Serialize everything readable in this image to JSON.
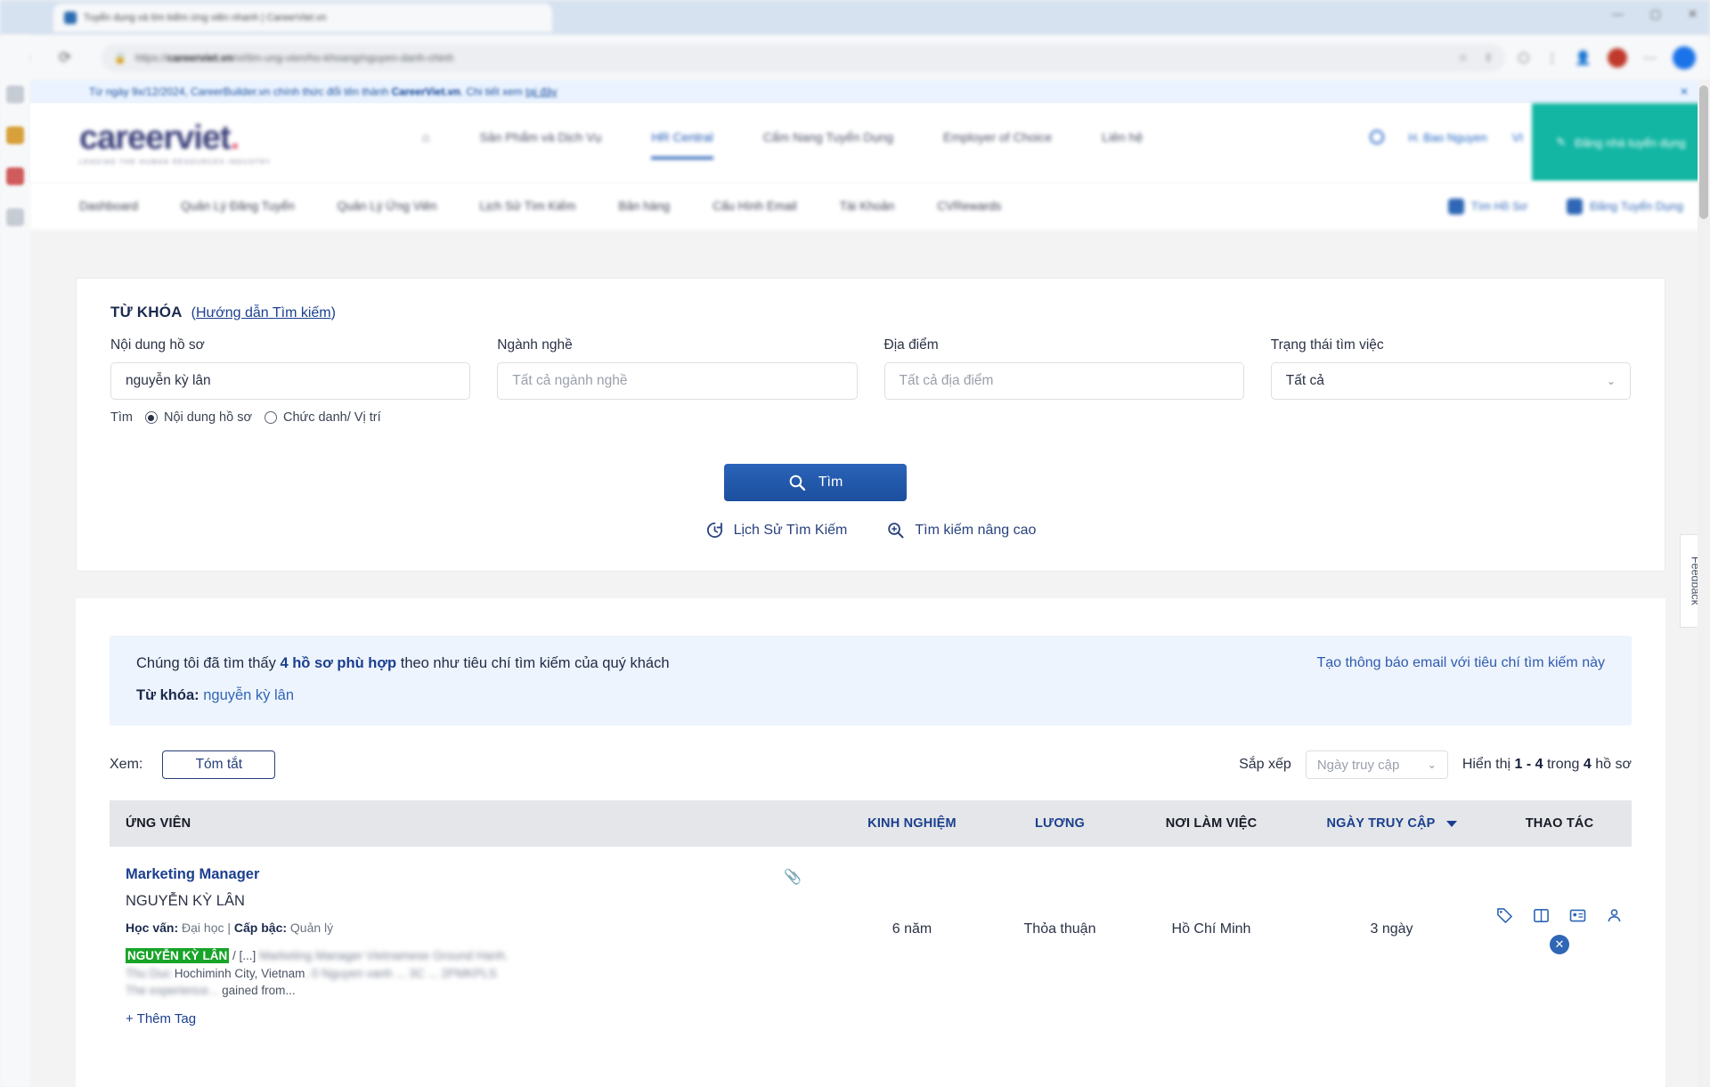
{
  "browser": {
    "tab_title": "Tuyển dụng và tìm kiếm ứng viên nhanh | CareerViet.vn",
    "url_domain": "careerviet.vn",
    "url_path": "/vi/tim-ung-vien/ho-khoang/nguyen-danh-chinh",
    "lock_icon": "lock-icon",
    "back_icon": "back-arrow-icon",
    "reload_icon": "reload-icon",
    "bookmark_icon": "bookmark-icon",
    "extensions_icon": "puzzle-icon",
    "minimize": "—",
    "maximize": "▢",
    "close": "✕"
  },
  "notice": {
    "text_before": "Từ ngày 9x/12/2024, CareerBuilder.vn chính thức đổi tên thành",
    "brand": "CareerViet.vn",
    "text_after": ". Chi tiết xem",
    "link": "tại đây",
    "close_icon": "close-icon"
  },
  "header": {
    "logo_text": "careerviet",
    "logo_tagline": "LEADING THE HUMAN RESOURCES INDUSTRY",
    "nav": [
      {
        "label": "Sản Phẩm và Dịch Vụ",
        "active": false
      },
      {
        "label": "HR Central",
        "active": true
      },
      {
        "label": "Cẩm Nang Tuyển Dụng",
        "active": false
      },
      {
        "label": "Employer of Choice",
        "active": false
      },
      {
        "label": "Liên hệ",
        "active": false
      }
    ],
    "user_name": "H. Bao Nguyen",
    "language": "VI",
    "cta_label": "Đăng nhà tuyển dụng",
    "cta_icon": "edit-square-icon"
  },
  "subnav": {
    "items": [
      "Dashboard",
      "Quản Lý Đăng Tuyển",
      "Quản Lý Ứng Viên",
      "Lịch Sử Tìm Kiếm",
      "Bản hàng",
      "Cấu Hình Email",
      "Tài Khoản",
      "CVRewards"
    ],
    "right": [
      {
        "label": "Tìm Hồ Sơ",
        "icon": "document-icon"
      },
      {
        "label": "Đăng Tuyển Dụng",
        "icon": "briefcase-icon"
      }
    ]
  },
  "search": {
    "keyword_title": "TỪ KHÓA",
    "guide_open": "(",
    "guide_label": "Hướng dẫn Tìm kiếm",
    "guide_close": ")",
    "fields": [
      {
        "label": "Nội dung hồ sơ",
        "value": "nguyễn kỳ lân",
        "placeholder": "",
        "type": "text"
      },
      {
        "label": "Ngành nghề",
        "value": "",
        "placeholder": "Tất cả ngành nghề",
        "type": "text"
      },
      {
        "label": "Địa điểm",
        "value": "",
        "placeholder": "Tất cả địa điểm",
        "type": "text"
      },
      {
        "label": "Trạng thái tìm việc",
        "value": "Tất cả",
        "placeholder": "",
        "type": "select"
      }
    ],
    "radio_prefix": "Tìm",
    "radios": [
      {
        "label": "Nội dung hồ sơ",
        "selected": true
      },
      {
        "label": "Chức danh/ Vị trí",
        "selected": false
      }
    ],
    "search_button": "Tìm",
    "search_icon": "search-icon",
    "links": [
      {
        "label": "Lịch Sử Tìm Kiếm",
        "icon": "history-clock-icon"
      },
      {
        "label": "Tìm kiếm nâng cao",
        "icon": "zoom-in-icon"
      }
    ]
  },
  "feedback_tab": "Feedback",
  "results": {
    "banner": {
      "prefix": "Chúng tôi đã tìm thấy",
      "count_text": "4 hồ sơ phù hợp",
      "suffix": "theo như tiêu chí tìm kiếm của quý khách",
      "keyword_label": "Từ khóa:",
      "keyword_value": "nguyễn kỳ lân",
      "email_alert_link": "Tạo thông báo email với tiêu chí tìm kiếm này"
    },
    "toolbar": {
      "view_label": "Xem:",
      "view_button": "Tóm tắt",
      "sort_label": "Sắp xếp",
      "sort_value": "Ngày truy cập",
      "sort_caret": "chevron-down-icon",
      "showing_prefix": "Hiển thị",
      "showing_range": "1 - 4",
      "showing_middle": "trong",
      "showing_total": "4",
      "showing_suffix": "hồ sơ"
    },
    "columns": [
      {
        "label": "ỨNG VIÊN",
        "accent": false
      },
      {
        "label": "KINH NGHIỆM",
        "accent": true
      },
      {
        "label": "LƯƠNG",
        "accent": true
      },
      {
        "label": "NƠI LÀM VIỆC",
        "accent": false
      },
      {
        "label": "NGÀY TRUY CẬP",
        "accent": true
      },
      {
        "label": "THAO TÁC",
        "accent": false
      }
    ],
    "rows": [
      {
        "title": "Marketing Manager",
        "name": "NGUYỄN KỲ LÂN",
        "edu_label": "Học vấn:",
        "edu_value": "Đại học",
        "separator": "|",
        "level_label": "Cấp bậc:",
        "level_value": "Quản lý",
        "snippet_highlights": [
          "NGUYỄN",
          "KỲ",
          "LÂN"
        ],
        "snippet_mid": "/ [...]",
        "snippet_blur1": "Marketing Manager Vietnamese Ground Hanh. Thu Duc",
        "snippet_line2_visible": "Hochiminh City, Vietnam",
        "snippet_blur2": ", 0 Nguyen vanh ... 3C ... 2PMKPLS  The experience...",
        "snippet_tail": "gained from...",
        "add_tag": "+ Thêm Tag",
        "attachment_icon": "paperclip-icon",
        "experience": "6 năm",
        "salary": "Thỏa thuận",
        "location": "Hồ Chí Minh",
        "last_access": "3 ngày",
        "actions": [
          "tag-icon",
          "book-icon",
          "contact-card-icon",
          "person-icon",
          "close-circle-icon"
        ]
      }
    ]
  }
}
